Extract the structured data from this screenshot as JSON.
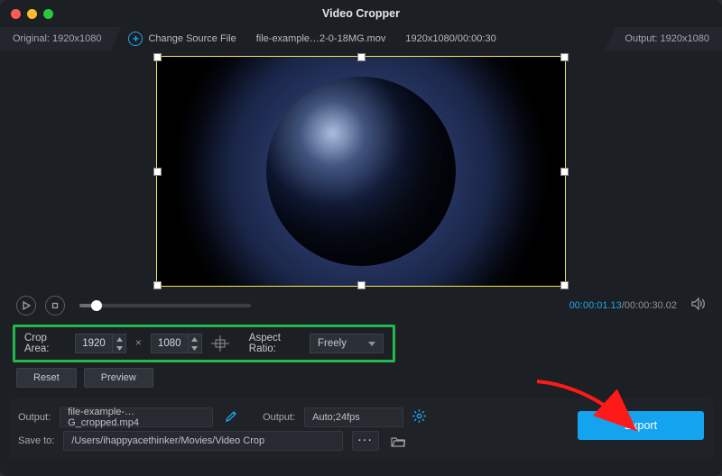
{
  "title": "Video Cropper",
  "infobar": {
    "original_label": "Original:",
    "original_value": "1920x1080",
    "change_source": "Change Source File",
    "file_name": "file-example…2-0-18MG.mov",
    "source_meta": "1920x1080/00:00:30",
    "output_label": "Output:",
    "output_value": "1920x1080"
  },
  "playback": {
    "current_time": "00:00:01.13",
    "total_time": "00:00:30.02"
  },
  "crop": {
    "label": "Crop Area:",
    "width": "1920",
    "height": "1080",
    "multiply": "×",
    "aspect_label": "Aspect Ratio:",
    "aspect_value": "Freely"
  },
  "buttons": {
    "reset": "Reset",
    "preview": "Preview",
    "export": "Export"
  },
  "output": {
    "label1": "Output:",
    "file": "file-example-…G_cropped.mp4",
    "label2": "Output:",
    "format": "Auto;24fps",
    "save_label": "Save to:",
    "save_path": "/Users/ihappyacethinker/Movies/Video Crop"
  }
}
